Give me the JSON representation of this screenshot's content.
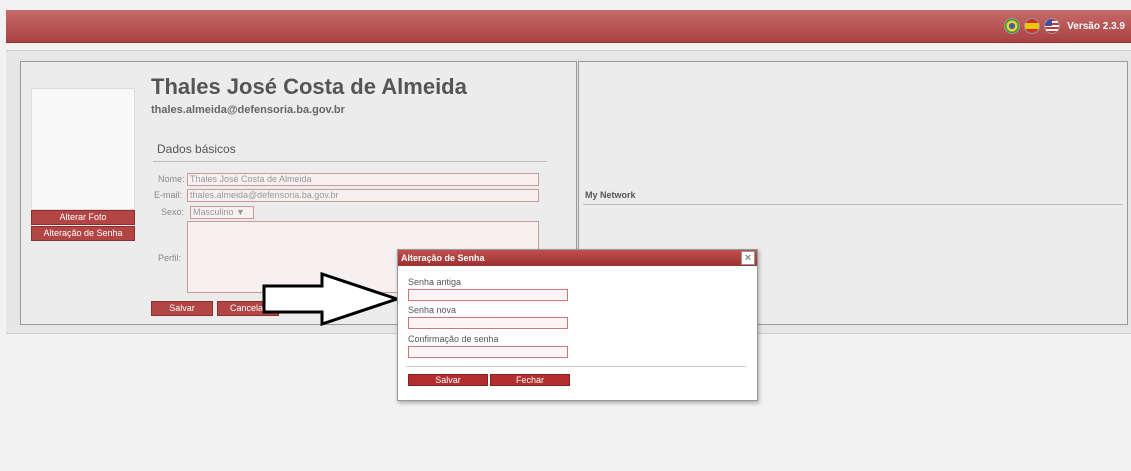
{
  "header": {
    "version": "Versão 2.3.9"
  },
  "profile": {
    "name": "Thales José Costa de Almeida",
    "email": "thales.almeida@defensoria.ba.gov.br",
    "section_title": "Dados básicos",
    "fields": {
      "nome_label": "Nome:",
      "nome_value": "Thales José Costa de Almeida",
      "email_label": "E-mail:",
      "email_value": "thales.almeida@defensoria.ba.gov.br",
      "sexo_label": "Sexo:",
      "sexo_value": "Masculino",
      "perfil_label": "Perfil:"
    },
    "buttons": {
      "alterar_foto": "Alterar Foto",
      "alterar_senha": "Alteração de Senha",
      "salvar": "Salvar",
      "cancelar": "Cancelar"
    }
  },
  "network": {
    "title": "My Network"
  },
  "dialog": {
    "title": "Alteração de Senha",
    "senha_antiga": "Senha antiga",
    "senha_nova": "Senha nova",
    "confirmacao": "Confirmação de senha",
    "salvar": "Salvar",
    "fechar": "Fechar"
  }
}
